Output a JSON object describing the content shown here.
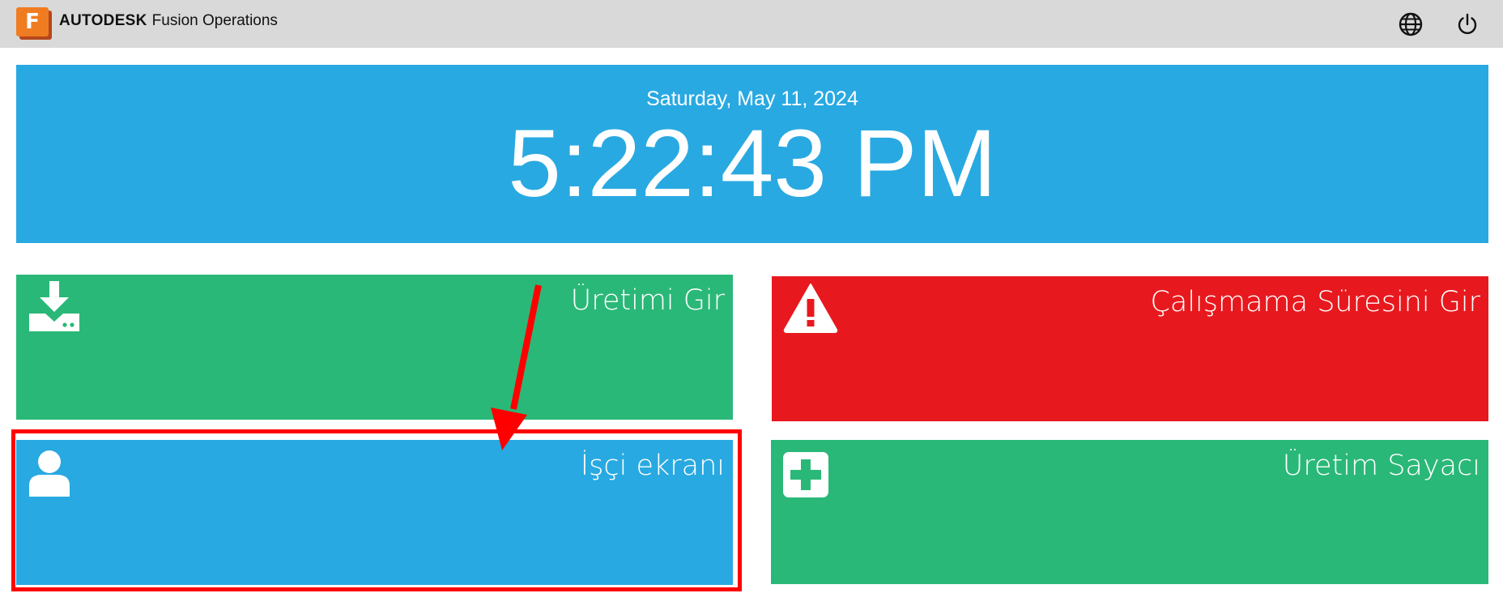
{
  "app": {
    "brand": "AUTODESK",
    "product": "Fusion Operations",
    "logo_letter": "F"
  },
  "header": {
    "icons": [
      "globe-icon",
      "power-icon"
    ]
  },
  "clock": {
    "date": "Saturday, May 11, 2024",
    "time": "5:22:43 PM"
  },
  "tiles": [
    {
      "label": "Üretimi Gir",
      "icon": "download-drive-icon",
      "color": "#2ab878"
    },
    {
      "label": "Çalışmama Süresini Gir",
      "icon": "warning-icon",
      "color": "#e8191e"
    },
    {
      "label": "İşçi ekranı",
      "icon": "user-icon",
      "color": "#29a9e1"
    },
    {
      "label": "Üretim Sayacı",
      "icon": "plus-square-icon",
      "color": "#2ab878"
    }
  ],
  "annotation": {
    "highlight_color": "#ff0000",
    "target": "İşçi ekranı"
  }
}
